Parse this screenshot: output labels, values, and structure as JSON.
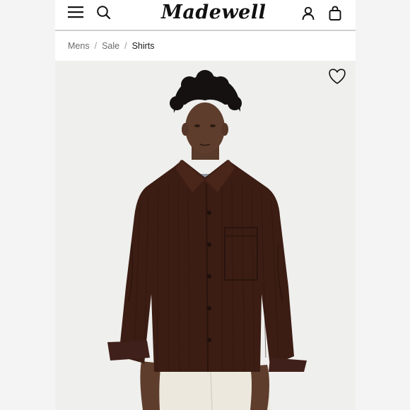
{
  "header": {
    "logo_text": "Madewell",
    "icons": [
      "menu-icon",
      "search-icon",
      "account-icon",
      "bag-icon"
    ]
  },
  "breadcrumb": {
    "items": [
      "Mens",
      "Sale",
      "Shirts"
    ],
    "separator": "/"
  },
  "product": {
    "image_alt_icon": "heart-icon",
    "colors": {
      "shirt": "#3b1d14",
      "pants": "#ece8dd",
      "background": "#efefed"
    }
  }
}
